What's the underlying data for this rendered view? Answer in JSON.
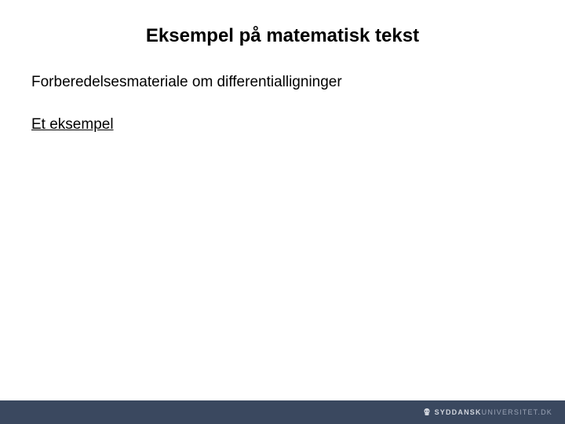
{
  "slide": {
    "title": "Eksempel på matematisk tekst",
    "body": "Forberedelsesmateriale om differentialligninger",
    "link": "Et eksempel"
  },
  "footer": {
    "brand_bold": "SYDDANSK",
    "brand_light": "UNIVERSITET",
    "brand_suffix": ".DK"
  }
}
